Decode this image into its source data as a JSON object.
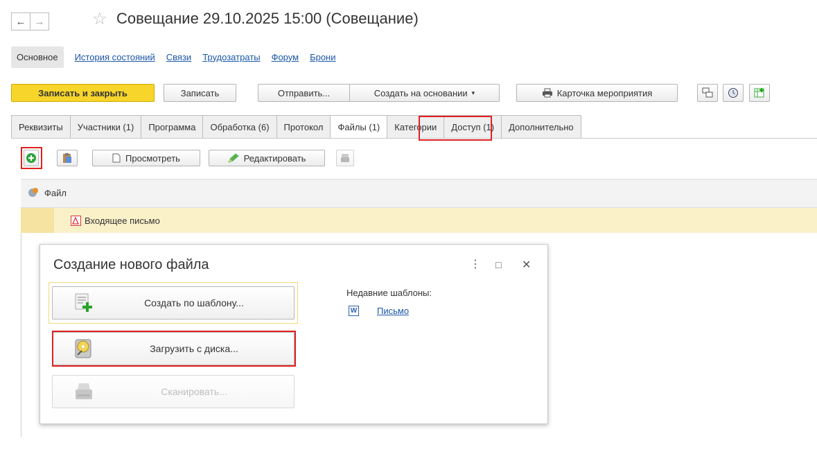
{
  "window": {
    "title": "Совещание  29.10.2025 15:00 (Совещание)",
    "back_icon": "←",
    "forward_icon": "→",
    "star_icon": "☆"
  },
  "subnav": {
    "active": "Основное",
    "links": [
      "История состояний",
      "Связи",
      "Трудозатраты",
      "Форум",
      "Брони"
    ]
  },
  "toolbar": {
    "save_close": "Записать и закрыть",
    "save": "Записать",
    "send": "Отправить...",
    "create_based": "Создать на основании",
    "event_card": "Карточка мероприятия"
  },
  "tabs": [
    "Реквизиты",
    "Участники (1)",
    "Программа",
    "Обработка (6)",
    "Протокол",
    "Файлы (1)",
    "Категории",
    "Доступ (1)",
    "Дополнительно"
  ],
  "files_toolbar": {
    "view": "Просмотреть",
    "edit": "Редактировать"
  },
  "grid": {
    "column_file": "Файл",
    "rows": [
      {
        "name": "Входящее письмо"
      }
    ]
  },
  "dialog": {
    "title": "Создание нового файла",
    "from_template": "Создать по шаблону...",
    "from_disk": "Загрузить с диска...",
    "scan": "Сканировать...",
    "recent_label": "Недавние шаблоны:",
    "recent_item": "Письмо",
    "more_icon": "⋮",
    "maximize_icon": "□",
    "close_icon": "✕"
  },
  "colors": {
    "accent_yellow": "#f7d52b",
    "link_blue": "#1a56a8",
    "highlight_red": "#e02020",
    "row_selected": "#fbf1c9"
  }
}
